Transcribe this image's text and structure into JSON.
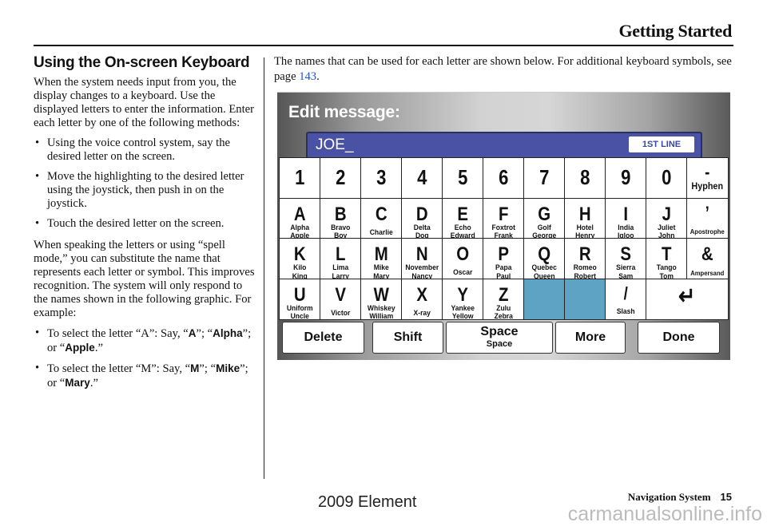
{
  "header": {
    "title": "Getting Started"
  },
  "left": {
    "section_title": "Using the On-screen Keyboard",
    "intro": "When the system needs input from you, the display changes to a keyboard. Use the displayed letters to enter the information. Enter each letter by one of the following methods:",
    "methods": [
      "Using the voice control system, say the desired letter on the screen.",
      "Move the highlighting to the desired letter using the joystick, then push in on the joystick.",
      "Touch the desired letter on the screen."
    ],
    "spell_para": "When speaking the letters or using “spell mode,” you can substitute the name that represents each letter or symbol. This improves recognition. The system will only respond to the names shown in the following graphic. For example:",
    "examples": [
      {
        "prefix": "To select the letter “A”: Say, “",
        "t1": "A",
        "mid1": "”; “",
        "t2": "Alpha",
        "mid2": "”; or “",
        "t3": "Apple",
        "suffix": ".”"
      },
      {
        "prefix": "To select the letter “M”: Say, “",
        "t1": "M",
        "mid1": "”; “",
        "t2": "Mike",
        "mid2": "”; or “",
        "t3": "Mary",
        "suffix": ".”"
      }
    ]
  },
  "right": {
    "intro_text": "The names that can be used for each letter are shown below. For additional keyboard symbols, see page ",
    "page_link": "143",
    "intro_end": "."
  },
  "keyboard": {
    "title": "Edit message:",
    "input_value": "JOE_",
    "line_badge": "1ST LINE",
    "rows": [
      [
        {
          "k": "1"
        },
        {
          "k": "2"
        },
        {
          "k": "3"
        },
        {
          "k": "4"
        },
        {
          "k": "5"
        },
        {
          "k": "6"
        },
        {
          "k": "7"
        },
        {
          "k": "8"
        },
        {
          "k": "9"
        },
        {
          "k": "0"
        },
        {
          "k": "-",
          "n1": "Hyphen"
        }
      ],
      [
        {
          "k": "A",
          "n1": "Alpha",
          "n2": "Apple"
        },
        {
          "k": "B",
          "n1": "Bravo",
          "n2": "Boy"
        },
        {
          "k": "C",
          "n1": "Charlie"
        },
        {
          "k": "D",
          "n1": "Delta",
          "n2": "Dog"
        },
        {
          "k": "E",
          "n1": "Echo",
          "n2": "Edward"
        },
        {
          "k": "F",
          "n1": "Foxtrot",
          "n2": "Frank"
        },
        {
          "k": "G",
          "n1": "Golf",
          "n2": "George"
        },
        {
          "k": "H",
          "n1": "Hotel",
          "n2": "Henry"
        },
        {
          "k": "I",
          "n1": "India",
          "n2": "Igloo"
        },
        {
          "k": "J",
          "n1": "Juliet",
          "n2": "John"
        },
        {
          "k": "’",
          "n1": "Apostrophe"
        }
      ],
      [
        {
          "k": "K",
          "n1": "Kilo",
          "n2": "King"
        },
        {
          "k": "L",
          "n1": "Lima",
          "n2": "Larry"
        },
        {
          "k": "M",
          "n1": "Mike",
          "n2": "Mary"
        },
        {
          "k": "N",
          "n1": "November",
          "n2": "Nancy"
        },
        {
          "k": "O",
          "n1": "Oscar"
        },
        {
          "k": "P",
          "n1": "Papa",
          "n2": "Paul"
        },
        {
          "k": "Q",
          "n1": "Quebec",
          "n2": "Queen"
        },
        {
          "k": "R",
          "n1": "Romeo",
          "n2": "Robert"
        },
        {
          "k": "S",
          "n1": "Sierra",
          "n2": "Sam"
        },
        {
          "k": "T",
          "n1": "Tango",
          "n2": "Tom"
        },
        {
          "k": "&",
          "n1": "Ampersand"
        }
      ],
      [
        {
          "k": "U",
          "n1": "Uniform",
          "n2": "Uncle"
        },
        {
          "k": "V",
          "n1": "Victor"
        },
        {
          "k": "W",
          "n1": "Whiskey",
          "n2": "William"
        },
        {
          "k": "X",
          "n1": "X-ray"
        },
        {
          "k": "Y",
          "n1": "Yankee",
          "n2": "Yellow"
        },
        {
          "k": "Z",
          "n1": "Zulu",
          "n2": "Zebra"
        },
        {
          "k": "",
          "blank": true
        },
        {
          "k": "",
          "blank": true
        },
        {
          "k": "/",
          "n1": "Slash"
        },
        {
          "k": "↵",
          "enter": true
        }
      ]
    ],
    "buttons": {
      "delete": "Delete",
      "shift": "Shift",
      "space": "Space",
      "space_sub": "Space",
      "more": "More",
      "done": "Done"
    },
    "colors": {
      "input_bg": "#4a52a6",
      "blank_key": "#5ea3c3"
    }
  },
  "footer": {
    "section": "Navigation System",
    "page": "15",
    "model": "2009  Element",
    "watermark": "carmanualsonline.info"
  }
}
